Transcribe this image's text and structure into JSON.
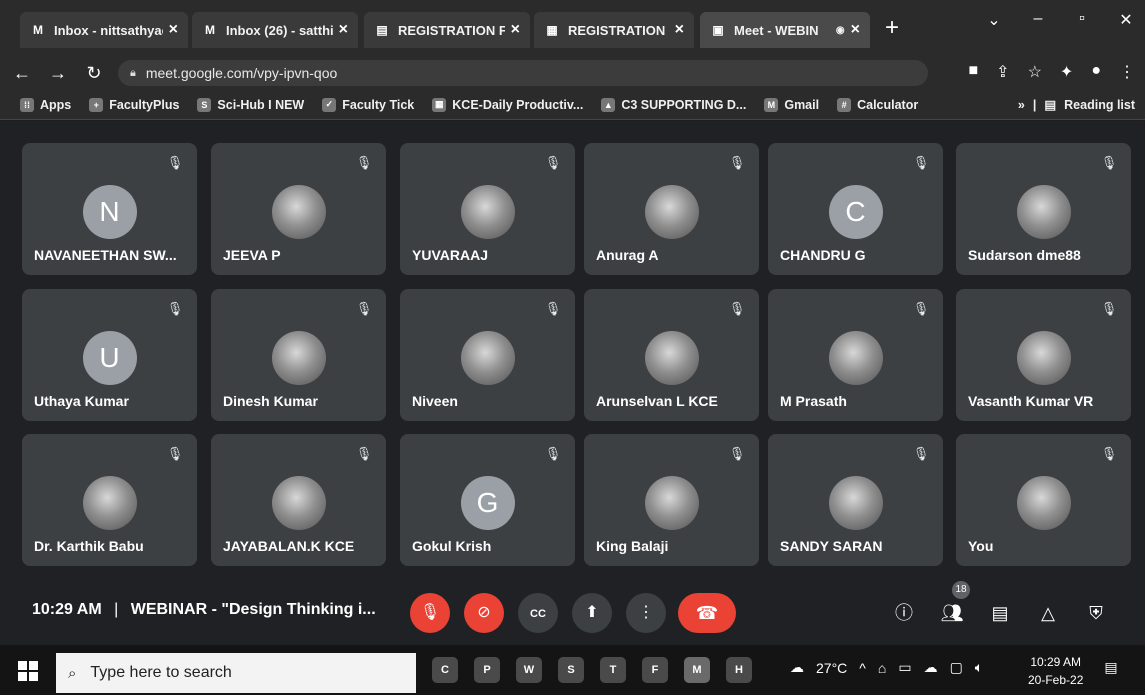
{
  "browser": {
    "tabs": [
      {
        "icon": "gmail-icon",
        "label": "Inbox - nittsathyac",
        "active": false
      },
      {
        "icon": "gmail-icon",
        "label": "Inbox (26) - satthi",
        "active": false
      },
      {
        "icon": "forms-icon",
        "label": "REGISTRATION FO",
        "active": false
      },
      {
        "icon": "sheets-icon",
        "label": "REGISTRATION FO",
        "active": false
      },
      {
        "icon": "meet-icon",
        "label": "Meet - WEBIN",
        "active": true
      }
    ],
    "url": "meet.google.com/vpy-ipvn-qoo",
    "bookmarks": [
      {
        "label": "Apps"
      },
      {
        "label": "FacultyPlus"
      },
      {
        "label": "Sci-Hub I NEW"
      },
      {
        "label": "Faculty Tick"
      },
      {
        "label": "KCE-Daily Productiv..."
      },
      {
        "label": "C3 SUPPORTING D..."
      },
      {
        "label": "Gmail"
      },
      {
        "label": "Calculator"
      }
    ],
    "reading_list": "Reading list"
  },
  "participants": [
    {
      "name": "NAVANEETHAN SW...",
      "initial": "N",
      "photo": false
    },
    {
      "name": "JEEVA P",
      "initial": "",
      "photo": true
    },
    {
      "name": "YUVARAAJ",
      "initial": "",
      "photo": true
    },
    {
      "name": "Anurag A",
      "initial": "",
      "photo": true
    },
    {
      "name": "CHANDRU G",
      "initial": "C",
      "photo": false
    },
    {
      "name": "Sudarson dme88",
      "initial": "",
      "photo": true
    },
    {
      "name": "Uthaya Kumar",
      "initial": "U",
      "photo": false
    },
    {
      "name": "Dinesh Kumar",
      "initial": "",
      "photo": true
    },
    {
      "name": "Niveen",
      "initial": "",
      "photo": true
    },
    {
      "name": "Arunselvan L KCE",
      "initial": "",
      "photo": true
    },
    {
      "name": "M Prasath",
      "initial": "",
      "photo": true
    },
    {
      "name": "Vasanth Kumar VR",
      "initial": "",
      "photo": true
    },
    {
      "name": "Dr. Karthik Babu",
      "initial": "",
      "photo": true
    },
    {
      "name": "JAYABALAN.K KCE",
      "initial": "",
      "photo": true
    },
    {
      "name": "Gokul Krish",
      "initial": "G",
      "photo": false
    },
    {
      "name": "King Balaji",
      "initial": "",
      "photo": true
    },
    {
      "name": "SANDY SARAN",
      "initial": "",
      "photo": true
    },
    {
      "name": "You",
      "initial": "",
      "photo": true
    }
  ],
  "meeting": {
    "time": "10:29 AM",
    "separator": "|",
    "title": "WEBINAR - \"Design Thinking i...",
    "people_count": "18"
  },
  "taskbar": {
    "search_placeholder": "Type here to search",
    "temperature": "27°C",
    "time": "10:29 AM",
    "date": "20-Feb-22",
    "apps": [
      "C",
      "P",
      "W",
      "S",
      "T",
      "F",
      "M",
      "H"
    ]
  }
}
